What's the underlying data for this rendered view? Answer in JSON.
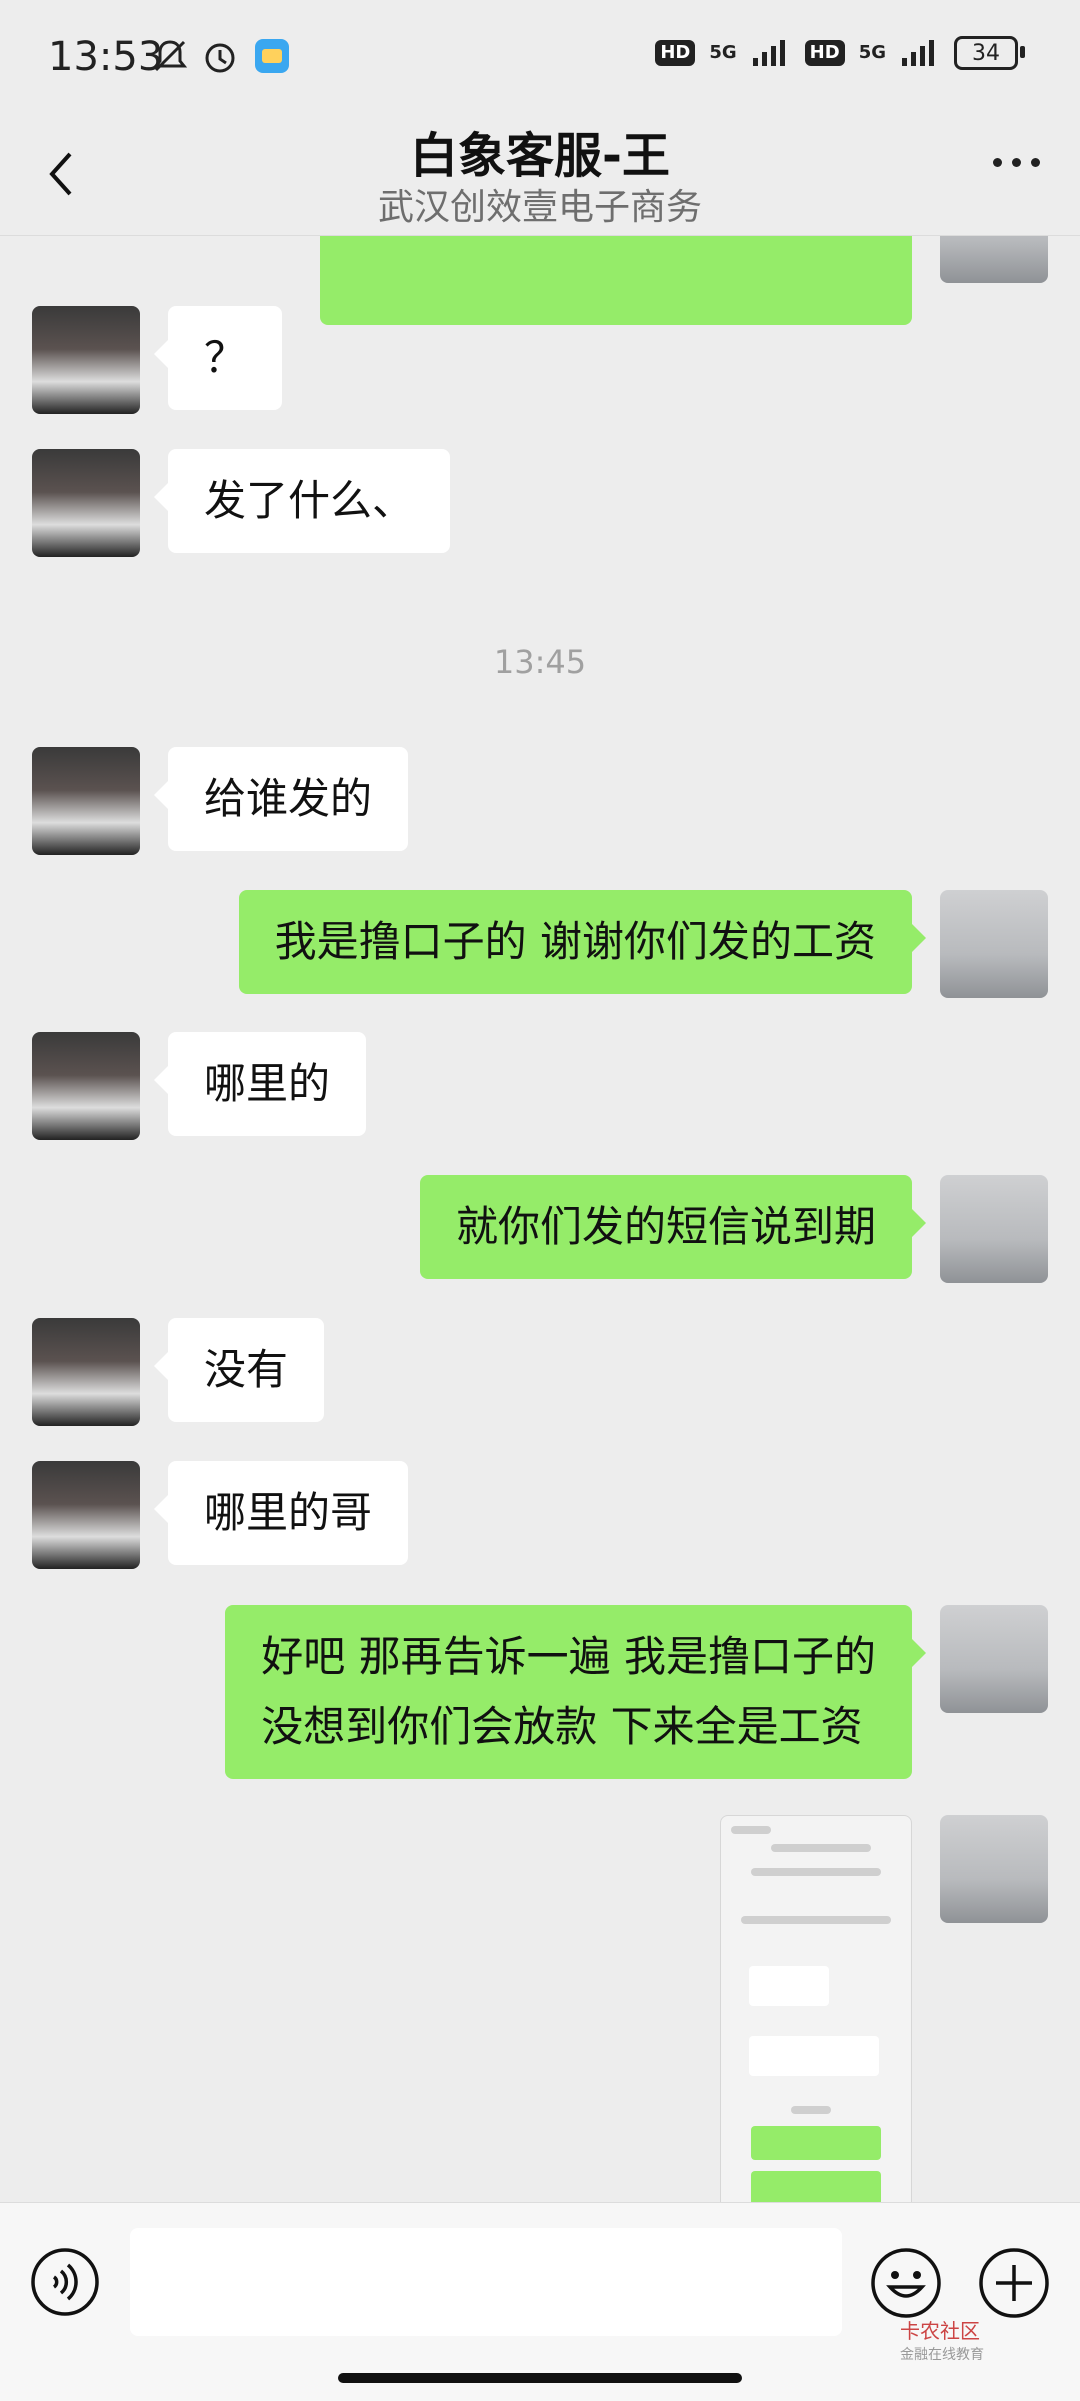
{
  "status": {
    "time": "13:53",
    "net1": "5G",
    "net2": "5G",
    "hd": "HD",
    "battery": "34"
  },
  "header": {
    "title": "白象客服-王",
    "subtitle": "武汉创效壹电子商务"
  },
  "messages": [
    {
      "side": "left",
      "text": "？"
    },
    {
      "side": "left",
      "text": "发了什么、"
    },
    {
      "timestamp": "13:45"
    },
    {
      "side": "left",
      "text": "给谁发的"
    },
    {
      "side": "right",
      "text": "我是撸口子的 谢谢你们发的工资"
    },
    {
      "side": "left",
      "text": "哪里的"
    },
    {
      "side": "right",
      "text": "就你们发的短信说到期"
    },
    {
      "side": "left",
      "text": "没有"
    },
    {
      "side": "left",
      "text": "哪里的哥"
    },
    {
      "side": "right",
      "text": "好吧 那再告诉一遍 我是撸口子的\n没想到你们会放款 下来全是工资"
    }
  ],
  "watermark": {
    "main": "卡农社区",
    "sub": "金融在线教育"
  }
}
